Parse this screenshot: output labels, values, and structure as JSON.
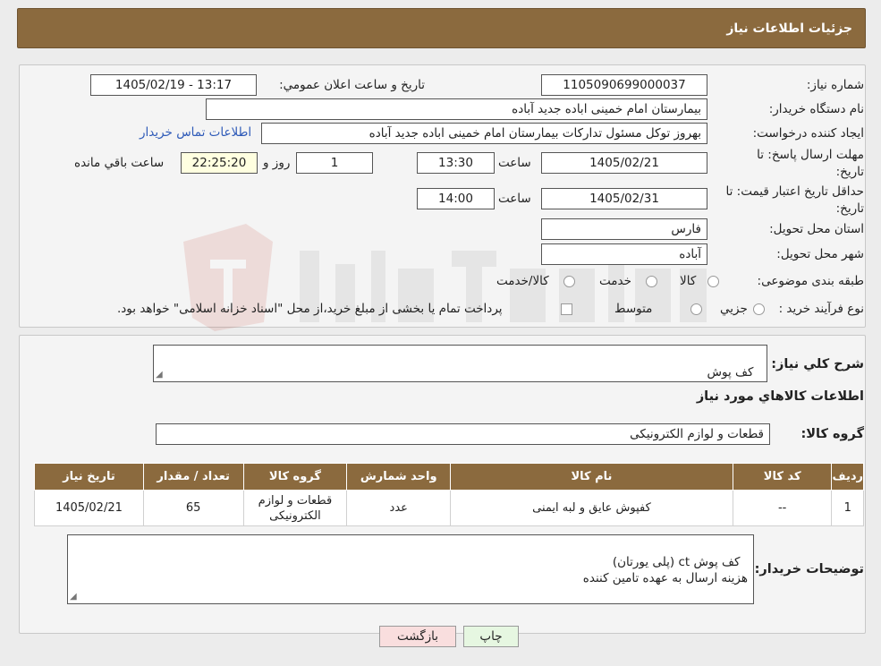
{
  "header": {
    "title": "جزئیات اطلاعات نیاز"
  },
  "form": {
    "need_number_label": "شماره نیاز:",
    "need_number": "1105090699000037",
    "announce_label": "تاريخ و ساعت اعلان عمومي:",
    "announce_value": "1405/02/19 - 13:17",
    "buyer_org_label": "نام دستگاه خريدار:",
    "buyer_org": "بيمارستان امام خمینی اباده جدید آباده",
    "requester_label": "ايجاد كننده درخواست:",
    "requester": "بهروز توکل مسئول تداركات بيمارستان امام خمینی اباده جدید آباده",
    "contact_link": "اطلاعات تماس خريدار",
    "reply_deadline_label": "مهلت ارسال پاسخ: تا تاريخ:",
    "reply_date": "1405/02/21",
    "time_label": "ساعت",
    "reply_time": "13:30",
    "days_value": "1",
    "days_label": "روز و",
    "remaining_time": "22:25:20",
    "remaining_label": "ساعت باقي مانده",
    "price_validity_label": "حداقل تاريخ اعتبار قيمت: تا تاريخ:",
    "validity_date": "1405/02/31",
    "validity_time": "14:00",
    "province_label": "استان محل تحويل:",
    "province": "فارس",
    "city_label": "شهر محل تحويل:",
    "city": "آباده",
    "category_label": "طبقه بندی موضوعی:",
    "category_options": [
      "كالا",
      "خدمت",
      "كالا/خدمت"
    ],
    "process_label": "نوع فرآيند خريد :",
    "process_options": [
      "جزيي",
      "متوسط"
    ],
    "payment_note": "پرداخت تمام يا بخشی از مبلغ خريد،از محل \"اسناد خزانه اسلامی\" خواهد بود."
  },
  "details": {
    "summary_label": "شرح كلي نياز:",
    "summary": "کف پوش",
    "goods_info_title": "اطلاعات كالاهاي مورد نياز",
    "goods_group_label": "گروه كالا:",
    "goods_group": "قطعات و لوازم الكترونيكی",
    "table": {
      "headers": [
        "رديف",
        "كد كالا",
        "نام كالا",
        "واحد شمارش",
        "گروه كالا",
        "تعداد / مقدار",
        "تاريخ نياز"
      ],
      "rows": [
        [
          "1",
          "--",
          "كفپوش عايق و لبه ايمنی",
          "عدد",
          "قطعات و لوازم الكترونيكی",
          "65",
          "1405/02/21"
        ]
      ]
    },
    "buyer_notes_label": "توضيحات خريدار:",
    "buyer_notes": "کف پوش ct (پلی یورتان)\nهزینه ارسال به عهده تامین کننده"
  },
  "buttons": {
    "print": "چاپ",
    "back": "بازگشت"
  },
  "colors": {
    "header": "#8b6a3e",
    "link": "#2e5ab8",
    "back_button": "#f9dede",
    "print_button": "#e6f7e1"
  }
}
